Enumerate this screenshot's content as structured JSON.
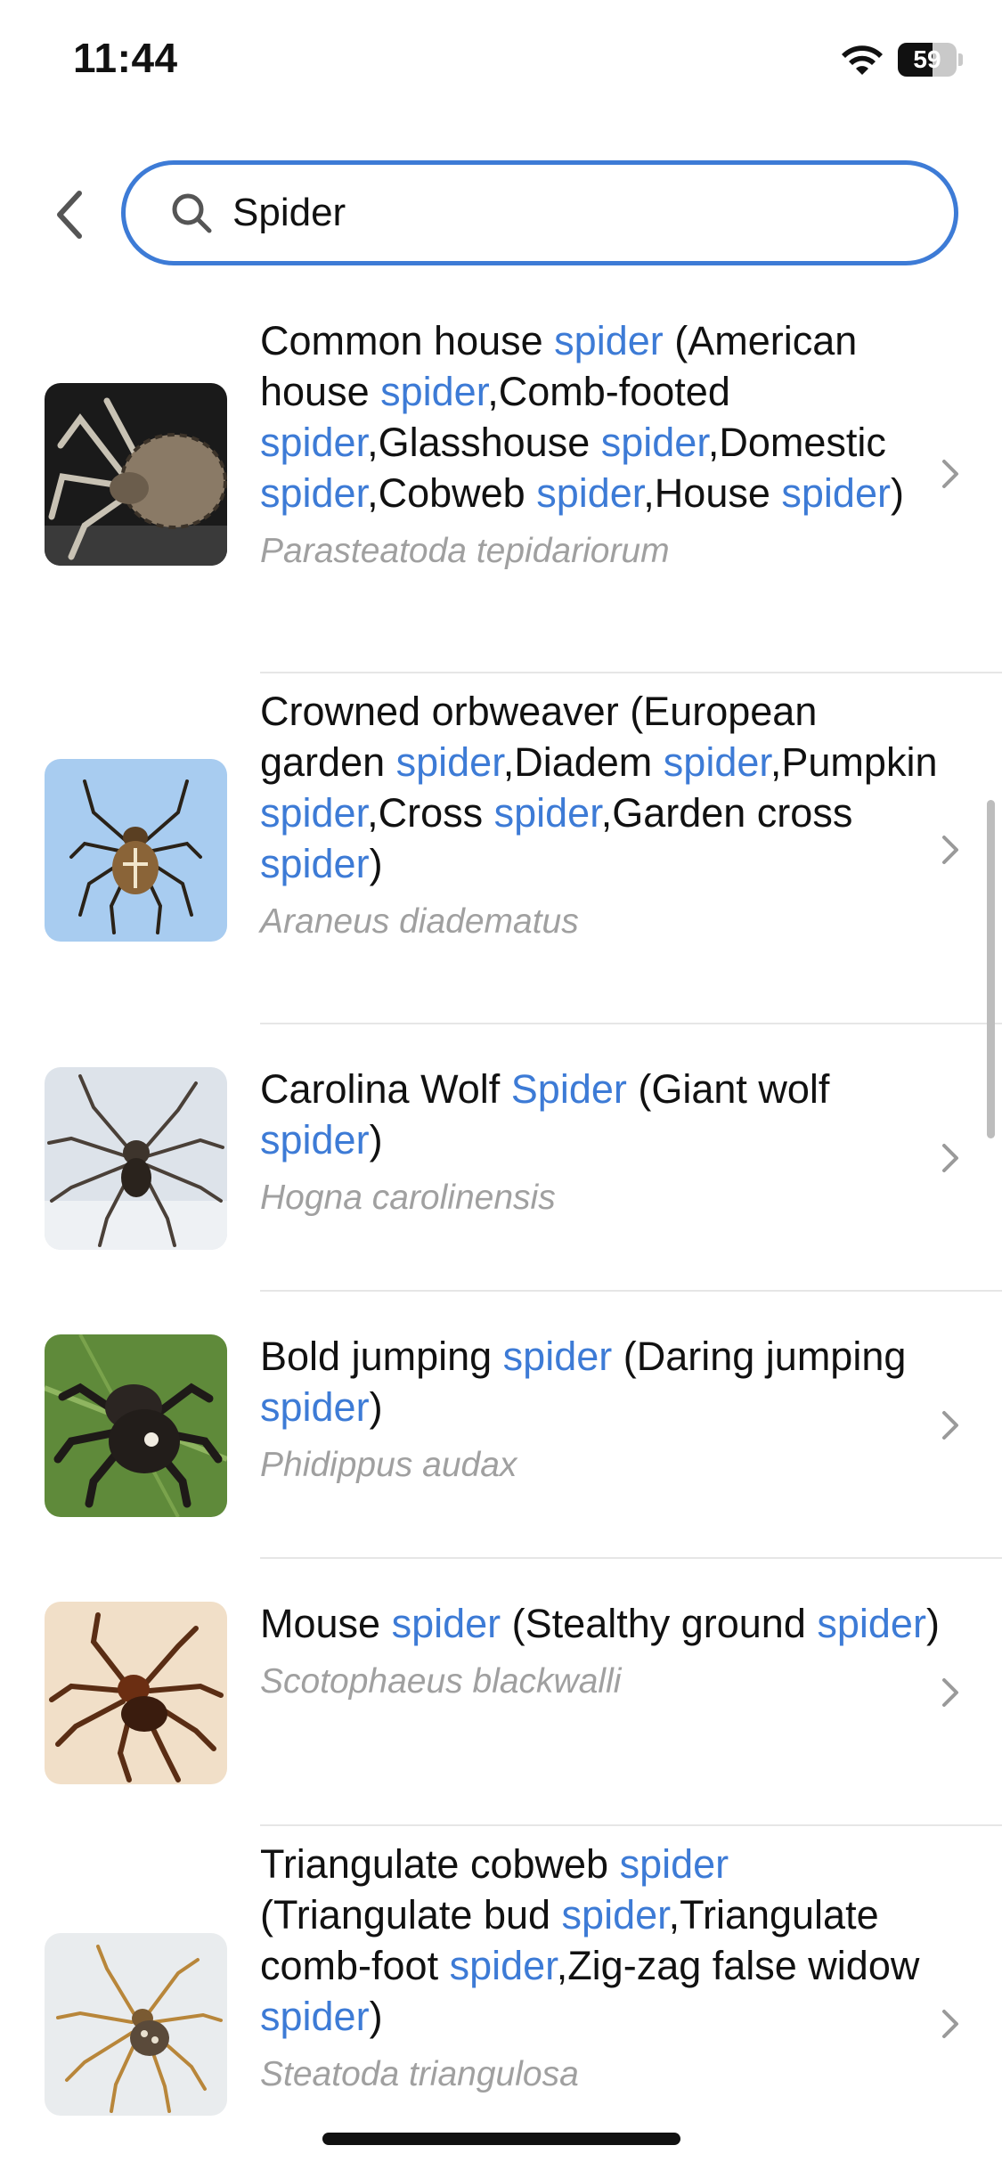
{
  "status_bar": {
    "time": "11:44",
    "battery_level": "59",
    "battery_fraction": 0.59
  },
  "search": {
    "value": "Spider",
    "placeholder": "",
    "accent": "#3d7bd6"
  },
  "results": [
    {
      "common_name_parts": [
        [
          "Common house ",
          false
        ],
        [
          "spider",
          true
        ],
        [
          " (American house ",
          false
        ],
        [
          "spider",
          true
        ],
        [
          ",Comb-footed ",
          false
        ],
        [
          "spider",
          true
        ],
        [
          ",Glasshouse ",
          false
        ],
        [
          "spider",
          true
        ],
        [
          ",Domestic ",
          false
        ],
        [
          "spider",
          true
        ],
        [
          ",Cobweb ",
          false
        ],
        [
          "spider",
          true
        ],
        [
          ",House ",
          false
        ],
        [
          "spider",
          true
        ],
        [
          ")",
          false
        ]
      ],
      "scientific_name": "Parasteatoda tepidariorum",
      "image": "house-spider-photo"
    },
    {
      "common_name_parts": [
        [
          "Crowned orbweaver (European garden ",
          false
        ],
        [
          "spider",
          true
        ],
        [
          ",Diadem ",
          false
        ],
        [
          "spider",
          true
        ],
        [
          ",Pumpkin ",
          false
        ],
        [
          "spider",
          true
        ],
        [
          ",Cross ",
          false
        ],
        [
          "spider",
          true
        ],
        [
          ",Garden cross ",
          false
        ],
        [
          "spider",
          true
        ],
        [
          ")",
          false
        ]
      ],
      "scientific_name": "Araneus diadematus",
      "image": "orbweaver-photo"
    },
    {
      "common_name_parts": [
        [
          "Carolina Wolf ",
          false
        ],
        [
          "Spider",
          true
        ],
        [
          " (Giant wolf ",
          false
        ],
        [
          "spider",
          true
        ],
        [
          ")",
          false
        ]
      ],
      "scientific_name": "Hogna carolinensis",
      "image": "wolf-spider-photo"
    },
    {
      "common_name_parts": [
        [
          "Bold jumping ",
          false
        ],
        [
          "spider",
          true
        ],
        [
          " (Daring jumping ",
          false
        ],
        [
          "spider",
          true
        ],
        [
          ")",
          false
        ]
      ],
      "scientific_name": "Phidippus audax",
      "image": "jumping-spider-photo"
    },
    {
      "common_name_parts": [
        [
          "Mouse ",
          false
        ],
        [
          "spider",
          true
        ],
        [
          " (Stealthy ground ",
          false
        ],
        [
          "spider",
          true
        ],
        [
          ")",
          false
        ]
      ],
      "scientific_name": "Scotophaeus blackwalli",
      "image": "mouse-spider-photo"
    },
    {
      "common_name_parts": [
        [
          "Triangulate cobweb ",
          false
        ],
        [
          "spider",
          true
        ],
        [
          " (Triangulate bud ",
          false
        ],
        [
          "spider",
          true
        ],
        [
          ",Triangulate comb-foot ",
          false
        ],
        [
          "spider",
          true
        ],
        [
          ",Zig-zag false widow ",
          false
        ],
        [
          "spider",
          true
        ],
        [
          ")",
          false
        ]
      ],
      "scientific_name": "Steatoda triangulosa",
      "image": "triangulate-spider-photo"
    }
  ]
}
